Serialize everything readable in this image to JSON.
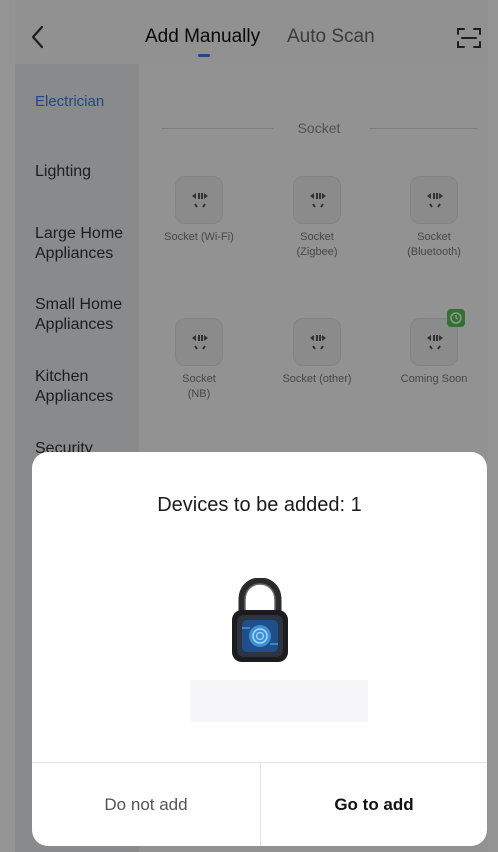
{
  "header": {
    "tabs": [
      {
        "label": "Add Manually",
        "active": true
      },
      {
        "label": "Auto Scan",
        "active": false
      }
    ],
    "back_icon": "chevron-left-icon",
    "scan_icon": "scan-frame-icon"
  },
  "sidebar": {
    "items": [
      {
        "label": "Electrician",
        "active": true
      },
      {
        "label": "Lighting"
      },
      {
        "label": "Large Home Appliances"
      },
      {
        "label": "Small Home Appliances"
      },
      {
        "label": "Kitchen Appliances"
      },
      {
        "label": "Security"
      }
    ]
  },
  "section": {
    "title": "Socket",
    "devices": [
      {
        "label": "Socket (Wi-Fi)",
        "icon": "socket-icon"
      },
      {
        "label": "Socket (Zigbee)",
        "icon": "socket-icon"
      },
      {
        "label": "Socket (Bluetooth)",
        "icon": "socket-icon"
      },
      {
        "label": "Socket (NB)",
        "icon": "socket-icon"
      },
      {
        "label": "Socket (other)",
        "icon": "socket-icon"
      },
      {
        "label": "Coming Soon",
        "icon": "socket-icon",
        "badge": "new-badge-icon"
      }
    ]
  },
  "dialog": {
    "title": "Devices to be added: 1",
    "device_icon": "padlock-icon",
    "cancel_label": "Do not add",
    "confirm_label": "Go to add"
  },
  "colors": {
    "accent": "#3a7be8",
    "badge": "#59c25a",
    "overlay": "rgba(0,0,0,0.42)"
  }
}
